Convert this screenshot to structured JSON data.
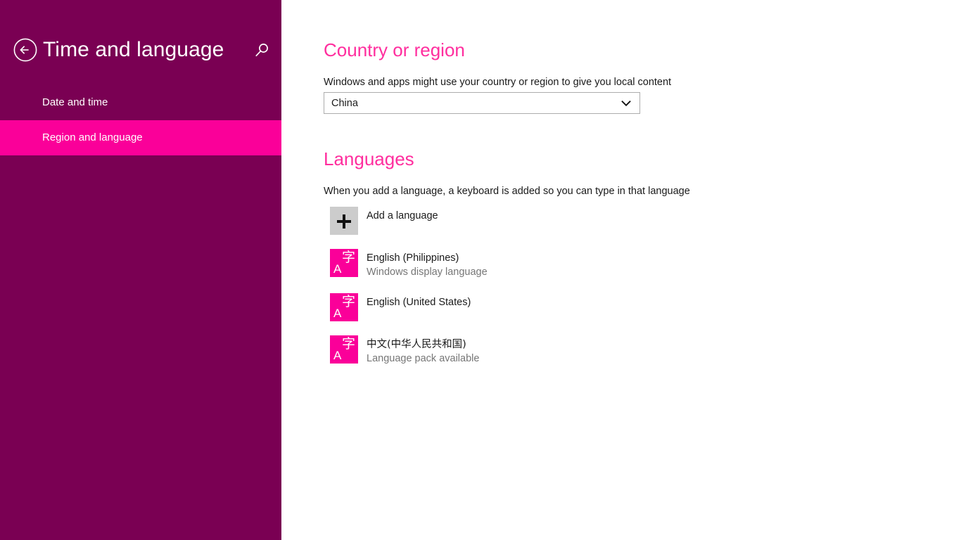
{
  "sidebar": {
    "title": "Time and language",
    "back_icon": "back-arrow-circle-icon",
    "search_icon": "search-icon",
    "items": [
      {
        "label": "Date and time",
        "selected": false
      },
      {
        "label": "Region and language",
        "selected": true
      }
    ],
    "colors": {
      "background": "#7a0053",
      "selected": "#fa0099",
      "text": "#ffffff"
    }
  },
  "main": {
    "country": {
      "heading": "Country or region",
      "description": "Windows and apps might use your country or region to give you local content",
      "select": {
        "value": "China",
        "chevron_icon": "chevron-down-icon"
      }
    },
    "languages": {
      "heading": "Languages",
      "description": "When you add a language, a keyboard is added so you can type in that language",
      "add_label": "Add a language",
      "add_icon": "plus-icon",
      "items": [
        {
          "title": "English (Philippines)",
          "subtitle": "Windows display language",
          "icon": "language-tile-icon"
        },
        {
          "title": "English (United States)",
          "subtitle": "",
          "icon": "language-tile-icon"
        },
        {
          "title": "中文(中华人民共和国)",
          "subtitle": "Language pack available",
          "icon": "language-tile-icon"
        }
      ],
      "tile_glyphs": {
        "latin": "A",
        "cjk": "字"
      }
    },
    "colors": {
      "heading": "#ff2e9e",
      "body_text": "#1a1a1a",
      "subtle_text": "#767676",
      "tile": "#fa0099",
      "add_tile": "#cccccc",
      "select_border": "#adadad"
    }
  }
}
